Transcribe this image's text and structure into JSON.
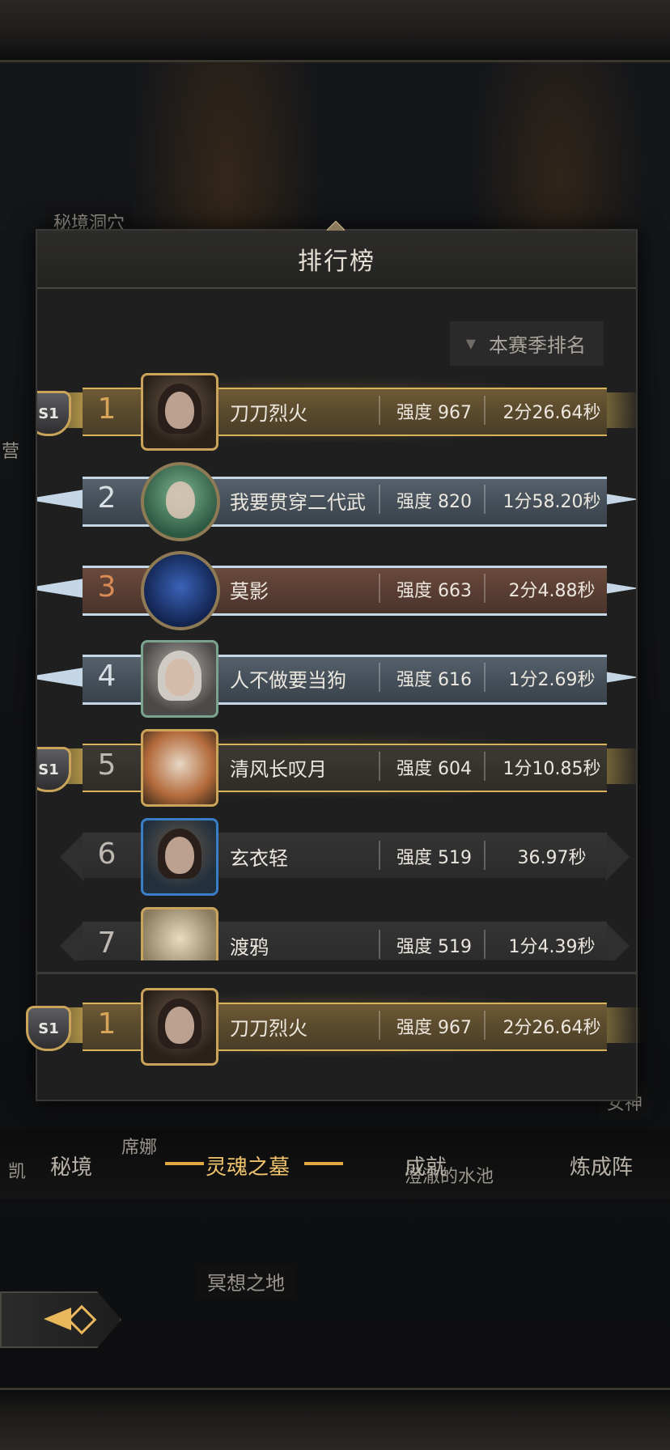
{
  "map_labels": {
    "top_left": "秘境洞穴",
    "left_edge": "营",
    "right_lower": "女神",
    "bottom_center": "冥想之地",
    "pool": "澄澈的水池",
    "left_bottom": "凯",
    "sina": "席娜"
  },
  "panel": {
    "title": "排行榜",
    "dropdown_label": "本赛季排名"
  },
  "rows": [
    {
      "rank": "1",
      "name": "刀刀烈火",
      "power": "强度 967",
      "time": "2分26.64秒",
      "badge": "S1",
      "tier": "gold"
    },
    {
      "rank": "2",
      "name": "我要贯穿二代武",
      "power": "强度 820",
      "time": "1分58.20秒",
      "badge": "",
      "tier": "ice"
    },
    {
      "rank": "3",
      "name": "莫影",
      "power": "强度 663",
      "time": "2分4.88秒",
      "badge": "",
      "tier": "bronze"
    },
    {
      "rank": "4",
      "name": "人不做要当狗",
      "power": "强度 616",
      "time": "1分2.69秒",
      "badge": "",
      "tier": "ice"
    },
    {
      "rank": "5",
      "name": "清风长叹月",
      "power": "强度 604",
      "time": "1分10.85秒",
      "badge": "S1",
      "tier": "gold"
    },
    {
      "rank": "6",
      "name": "玄衣轻",
      "power": "强度 519",
      "time": "36.97秒",
      "badge": "",
      "tier": "plain"
    },
    {
      "rank": "7",
      "name": "渡鸦",
      "power": "强度 519",
      "time": "1分4.39秒",
      "badge": "",
      "tier": "plain"
    }
  ],
  "my_row": {
    "rank": "1",
    "name": "刀刀烈火",
    "power": "强度 967",
    "time": "2分26.64秒",
    "badge": "S1"
  },
  "tabs": [
    {
      "label": "秘境"
    },
    {
      "label": "灵魂之墓"
    },
    {
      "label": "成就"
    },
    {
      "label": "炼成阵"
    }
  ],
  "colors": {
    "gold": "#d9b35a",
    "ice": "#c5d6e6",
    "active_tab": "#f1c36d"
  }
}
